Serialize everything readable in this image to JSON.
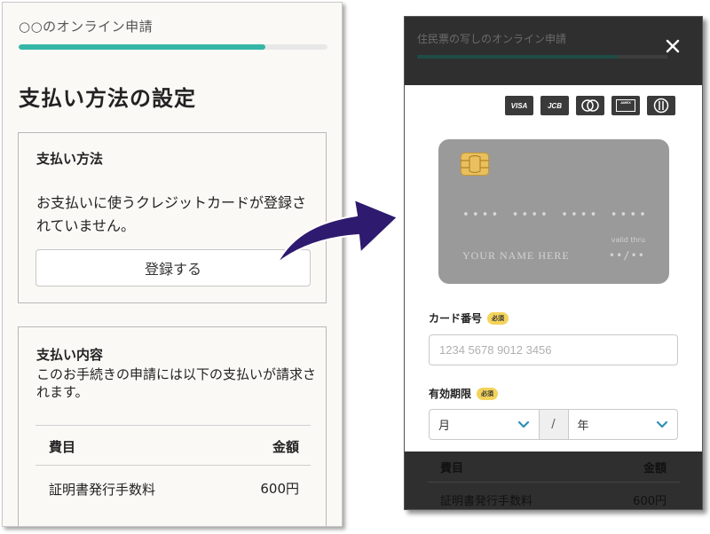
{
  "left": {
    "app_title": "○○のオンライン申請",
    "progress_percent": 80,
    "page_title": "支払い方法の設定",
    "payment_method": {
      "heading": "支払い方法",
      "message": "お支払いに使うクレジットカードが登録されていません。",
      "register_button": "登録する"
    },
    "payment_details": {
      "heading": "支払い内容",
      "message": "このお手続きの申請には以下の支払いが請求されます。",
      "col_item": "費目",
      "col_amount": "金額",
      "rows": [
        {
          "item": "証明書発行手数料",
          "amount": "600円"
        }
      ]
    }
  },
  "right": {
    "bg_title": "住民票の写しのオンライン申請",
    "bg_progress_percent": 80,
    "brands": [
      "VISA",
      "JCB",
      "mastercard",
      "AMERICAN EXPRESS",
      "Diners Club"
    ],
    "card_preview": {
      "number_groups": [
        "••••",
        "••••",
        "••••",
        "••••"
      ],
      "name": "YOUR NAME HERE",
      "valid_label": "valid thru",
      "expiry": "••/••"
    },
    "card_number": {
      "label": "カード番号",
      "required": "必須",
      "placeholder": "1234 5678 9012 3456"
    },
    "expiry": {
      "label": "有効期限",
      "required": "必須",
      "month": "月",
      "separator": "/",
      "year": "年"
    },
    "bg_table": {
      "col_item": "費目",
      "col_amount": "金額",
      "row_item": "証明書発行手数料",
      "row_amount": "600円"
    }
  },
  "colors": {
    "progress": "#35b6a6",
    "arrow": "#2e1a6e",
    "overlay": "#2f2f2f",
    "required_badge": "#f3d35b",
    "chevron": "#2d8fb5"
  },
  "icons": [
    "close-icon",
    "chip-icon",
    "chevron-down-icon",
    "arrow-icon"
  ]
}
